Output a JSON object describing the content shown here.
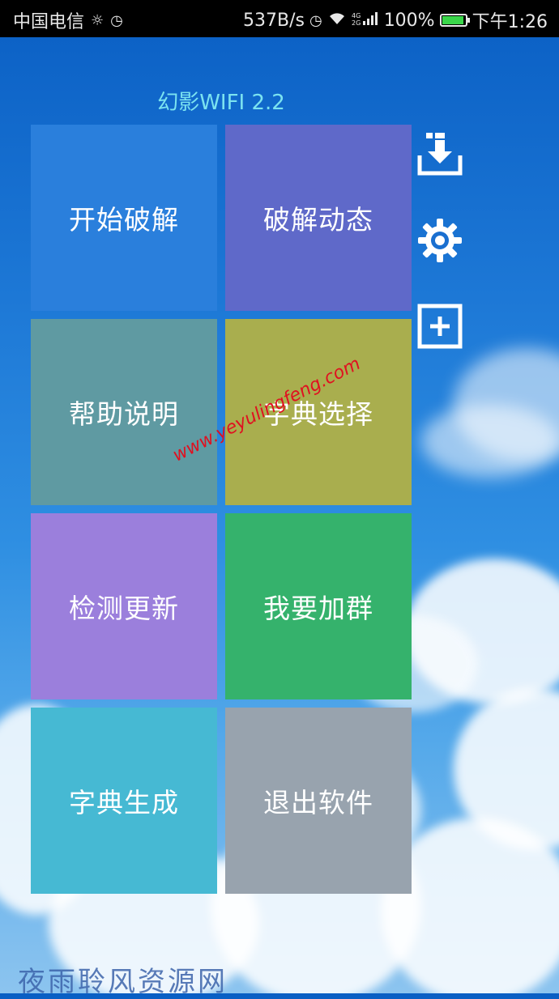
{
  "status_bar": {
    "carrier": "中国电信",
    "net_speed": "537B/s",
    "battery": "100%",
    "time": "下午1:26",
    "icons": [
      "brightness-icon",
      "alarm-icon",
      "alarm-icon",
      "wifi-icon",
      "signal-icon",
      "battery-icon"
    ]
  },
  "app": {
    "title": "幻影WIFI 2.2"
  },
  "tiles": [
    {
      "label": "开始破解",
      "color": "#2a7fdc"
    },
    {
      "label": "破解动态",
      "color": "#5f69c9"
    },
    {
      "label": "帮助说明",
      "color": "#5f9aa2"
    },
    {
      "label": "字典选择",
      "color": "#a9ae4e"
    },
    {
      "label": "检测更新",
      "color": "#9b7fdc"
    },
    {
      "label": "我要加群",
      "color": "#35b26c"
    },
    {
      "label": "字典生成",
      "color": "#46b9d3"
    },
    {
      "label": "退出软件",
      "color": "#98a3ae"
    }
  ],
  "side_icons": [
    "download-icon",
    "gear-icon",
    "add-icon"
  ],
  "watermark": "www.yeyulingfeng.com",
  "footer_watermark": "夜雨聆风资源网"
}
